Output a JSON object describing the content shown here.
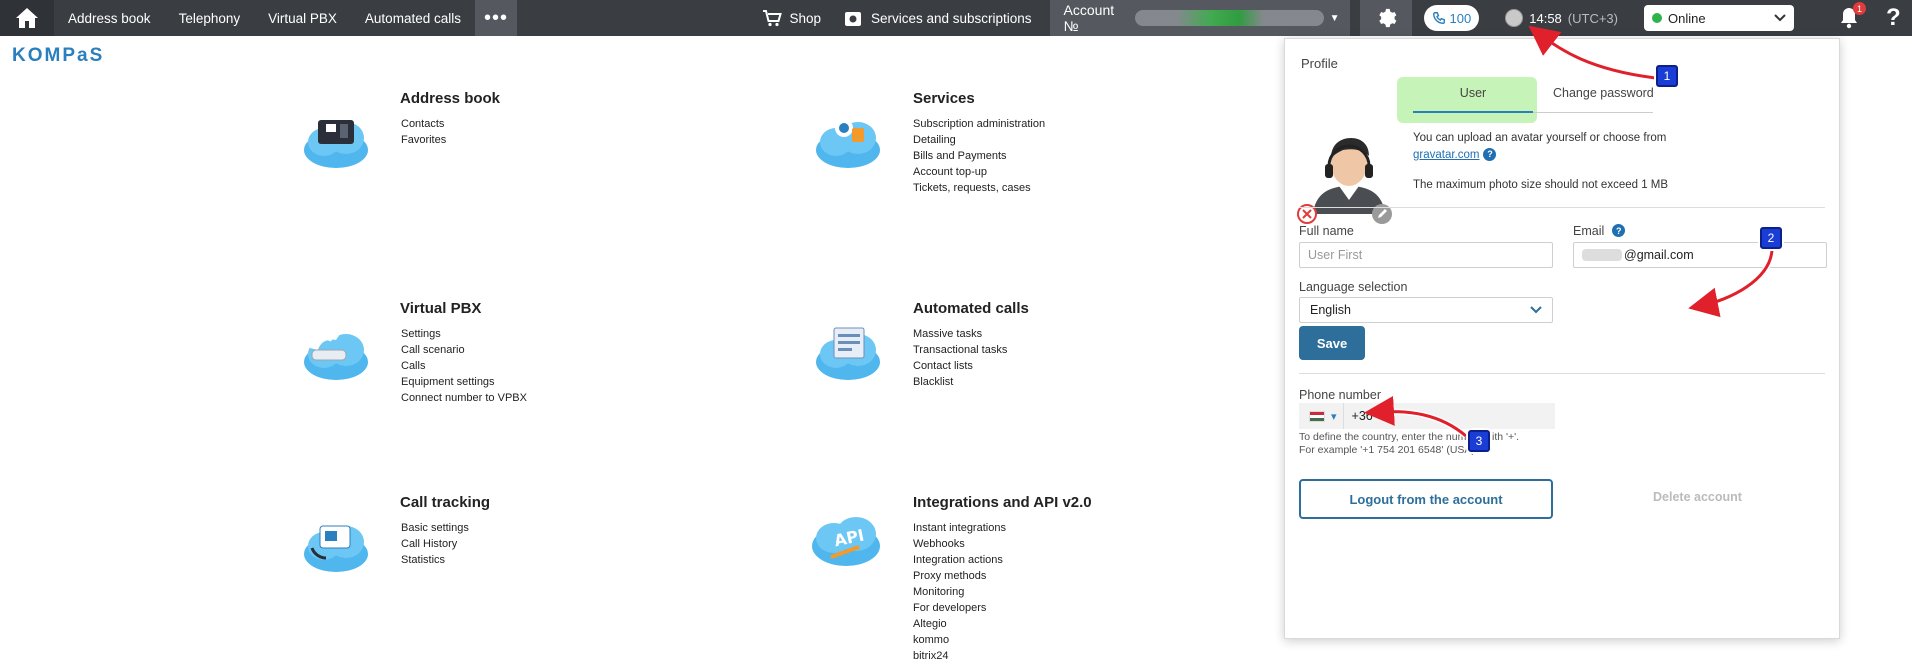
{
  "nav": {
    "items": [
      "Address book",
      "Telephony",
      "Virtual PBX",
      "Automated calls"
    ],
    "more": "•••",
    "shop": "Shop",
    "services": "Services and subscriptions",
    "account_prefix": "Account №",
    "calls_count": "100",
    "time": "14:58",
    "timezone": "(UTC+3)",
    "status": "Online",
    "notifications_count": "1",
    "help": "?"
  },
  "logo": "KOMPaS",
  "tiles": [
    {
      "title": "Address book",
      "links": [
        "Contacts",
        "Favorites"
      ]
    },
    {
      "title": "Services",
      "links": [
        "Subscription administration",
        "Detailing",
        "Bills and Payments",
        "Account top-up",
        "Tickets, requests, cases"
      ]
    },
    {
      "title": "Virtual PBX",
      "links": [
        "Settings",
        "Call scenario",
        "Calls",
        "Equipment settings",
        "Connect number to VPBX"
      ]
    },
    {
      "title": "Automated calls",
      "links": [
        "Massive tasks",
        "Transactional tasks",
        "Contact lists",
        "Blacklist"
      ]
    },
    {
      "title": "Call tracking",
      "links": [
        "Basic settings",
        "Call History",
        "Statistics"
      ]
    },
    {
      "title": "Integrations and API v2.0",
      "links": [
        "Instant integrations",
        "Webhooks",
        "Integration actions",
        "Proxy methods",
        "Monitoring",
        "For developers",
        "Altegio",
        "kommo",
        "bitrix24"
      ]
    }
  ],
  "profile": {
    "title": "Profile",
    "tab_user": "User",
    "tab_password": "Change password",
    "avatar_note": "You can upload an avatar yourself or choose from",
    "gravatar_link": "gravatar.com",
    "size_note": "The maximum photo size should not exceed 1 MB",
    "full_name_label": "Full name",
    "full_name_placeholder": "User First",
    "email_label": "Email",
    "email_value": "@gmail.com",
    "language_label": "Language selection",
    "language_value": "English",
    "save": "Save",
    "phone_label": "Phone number",
    "phone_value": "+36",
    "phone_hint_1": "To define the country, enter the number with '+'.",
    "phone_hint_2": "For example '+1 754 201 6548' (USA).",
    "logout": "Logout from the account",
    "delete": "Delete account"
  },
  "annotations": [
    "1",
    "2",
    "3"
  ],
  "colors": {
    "topbar": "#3a3d42",
    "accent": "#2d6f9a",
    "highlight": "#c6f3b7",
    "arrow": "#e0202a",
    "badge": "#1a3dd6",
    "online": "#2db34a"
  }
}
